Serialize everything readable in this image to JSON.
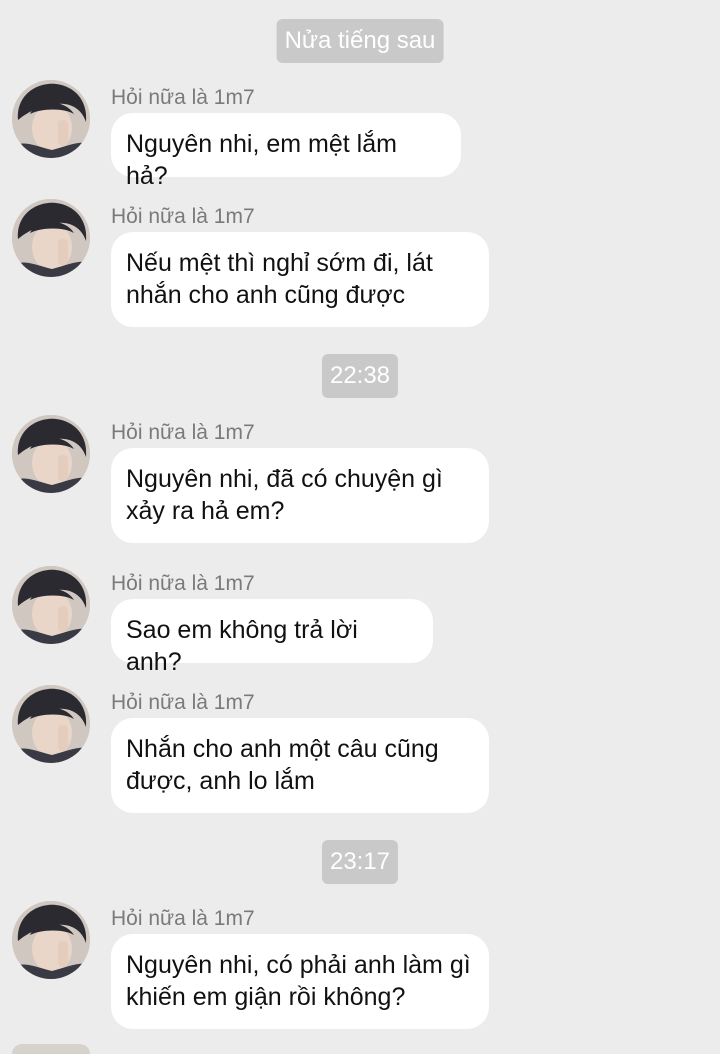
{
  "timestamps": {
    "t0": "Nửa tiếng sau",
    "t1": "22:38",
    "t2": "23:17"
  },
  "sender_name": "Hỏi nữa là 1m7",
  "messages": [
    {
      "text": "Nguyên nhi, em mệt lắm hả?"
    },
    {
      "text": "Nếu mệt thì nghỉ sớm đi, lát\nnhắn cho anh cũng được"
    },
    {
      "text": "Nguyên nhi, đã có chuyện gì\nxảy ra hả em?"
    },
    {
      "text": "Sao em không trả lời anh?"
    },
    {
      "text": "Nhắn cho anh một câu cũng\nđược, anh lo lắm"
    },
    {
      "text": "Nguyên nhi, có phải anh làm gì\nkhiến em giận rồi không?"
    }
  ],
  "colors": {
    "background": "#ececec",
    "bubble": "#ffffff",
    "timestamp_pill": "#c9c9c9",
    "sender_text": "#7a7a7a"
  }
}
